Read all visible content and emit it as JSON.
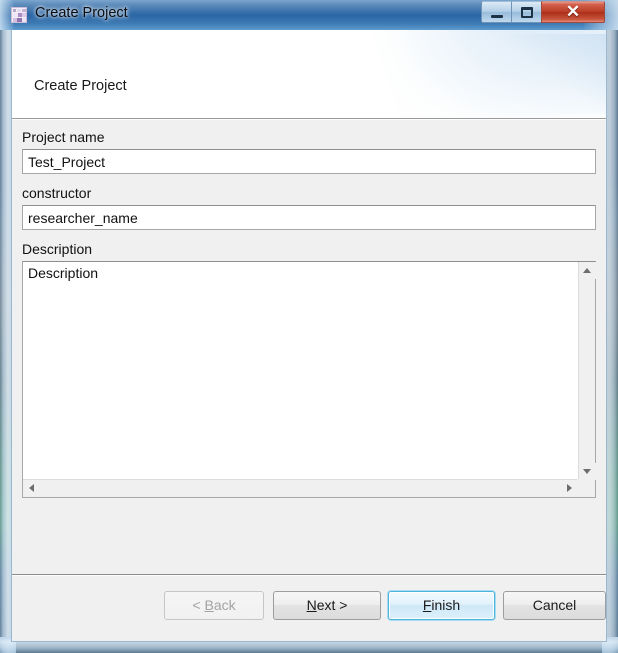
{
  "window": {
    "title": "Create Project",
    "icon": "app-icon",
    "controls": {
      "minimize": {
        "name": "minimize-button",
        "glyph": "—"
      },
      "maximize": {
        "name": "maximize-button",
        "glyph": "▢"
      },
      "close": {
        "name": "close-button",
        "glyph": "✕"
      }
    }
  },
  "header": {
    "title": "Create Project"
  },
  "form": {
    "fields": [
      {
        "label": "Project name",
        "value": "Test_Project",
        "placeholder": "Project name"
      },
      {
        "label": "constructor",
        "value": "researcher_name",
        "placeholder": "constructor"
      },
      {
        "label": "Description",
        "value": "Description",
        "placeholder": "Description"
      }
    ]
  },
  "scrollbars": {
    "vertical": {
      "up_icon": "scroll-up-arrow-icon",
      "down_icon": "scroll-down-arrow-icon"
    },
    "horizontal": {
      "left_icon": "scroll-left-arrow-icon",
      "right_icon": "scroll-right-arrow-icon"
    }
  },
  "buttons": {
    "back": {
      "label": "< Back",
      "mnemonic": "B",
      "enabled": false,
      "default": false
    },
    "next": {
      "label": "Next >",
      "mnemonic": "N",
      "enabled": true,
      "default": false
    },
    "finish": {
      "label": "Finish",
      "mnemonic": "F",
      "enabled": true,
      "default": true
    },
    "cancel": {
      "label": "Cancel",
      "mnemonic": "",
      "enabled": true,
      "default": false
    }
  },
  "colors": {
    "title_bar": "#2f69a6",
    "close_button": "#bb3e27",
    "default_button_border": "#4fb4dd",
    "dialog_background": "#f0f0f0",
    "header_background": "#ffffff"
  }
}
